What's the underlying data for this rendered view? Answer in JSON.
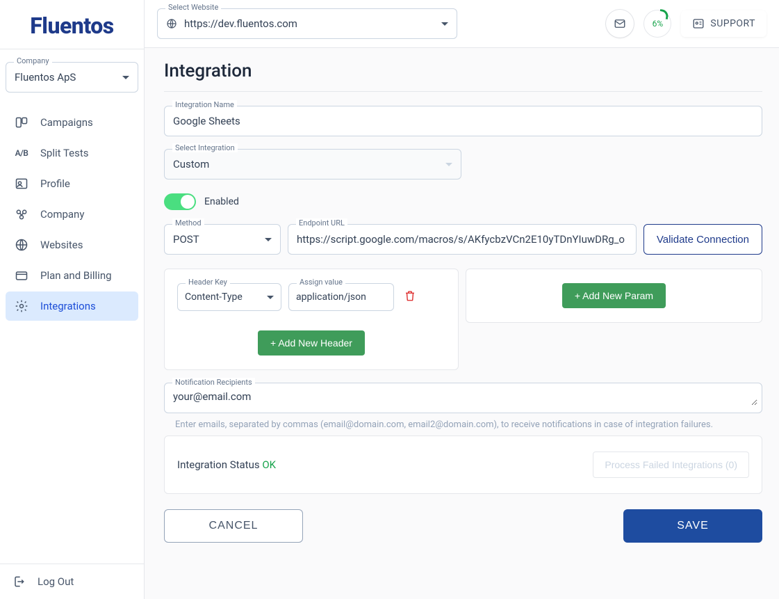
{
  "logo": "Fluentos",
  "company": {
    "label": "Company",
    "value": "Fluentos ApS"
  },
  "nav": {
    "campaigns": "Campaigns",
    "split_tests": "Split Tests",
    "profile": "Profile",
    "company": "Company",
    "websites": "Websites",
    "billing": "Plan and Billing",
    "integrations": "Integrations"
  },
  "logout": "Log Out",
  "topbar": {
    "website_label": "Select Website",
    "website_value": "https://dev.fluentos.com",
    "progress": "6%",
    "support": "SUPPORT"
  },
  "page": {
    "title": "Integration",
    "name_label": "Integration Name",
    "name_value": "Google Sheets",
    "select_int_label": "Select Integration",
    "select_int_value": "Custom",
    "enabled": "Enabled",
    "method_label": "Method",
    "method_value": "POST",
    "url_label": "Endpoint URL",
    "url_value": "https://script.google.com/macros/s/AKfycbzVCn2E10yTDnYIuwDRg_o",
    "validate": "Validate Connection",
    "header_key_label": "Header Key",
    "header_key_value": "Content-Type",
    "header_val_label": "Assign value",
    "header_val_value": "application/json",
    "add_header": "+ Add New Header",
    "add_param": "+ Add New Param",
    "notif_label": "Notification Recipients",
    "notif_value": "your@email.com",
    "notif_help": "Enter emails, separated by commas (email@domain.com, email2@domain.com), to receive notifications in case of integration failures.",
    "status_label": "Integration Status",
    "status_value": "OK",
    "process_failed": "Process Failed Integrations (0)",
    "cancel": "CANCEL",
    "save": "SAVE"
  }
}
